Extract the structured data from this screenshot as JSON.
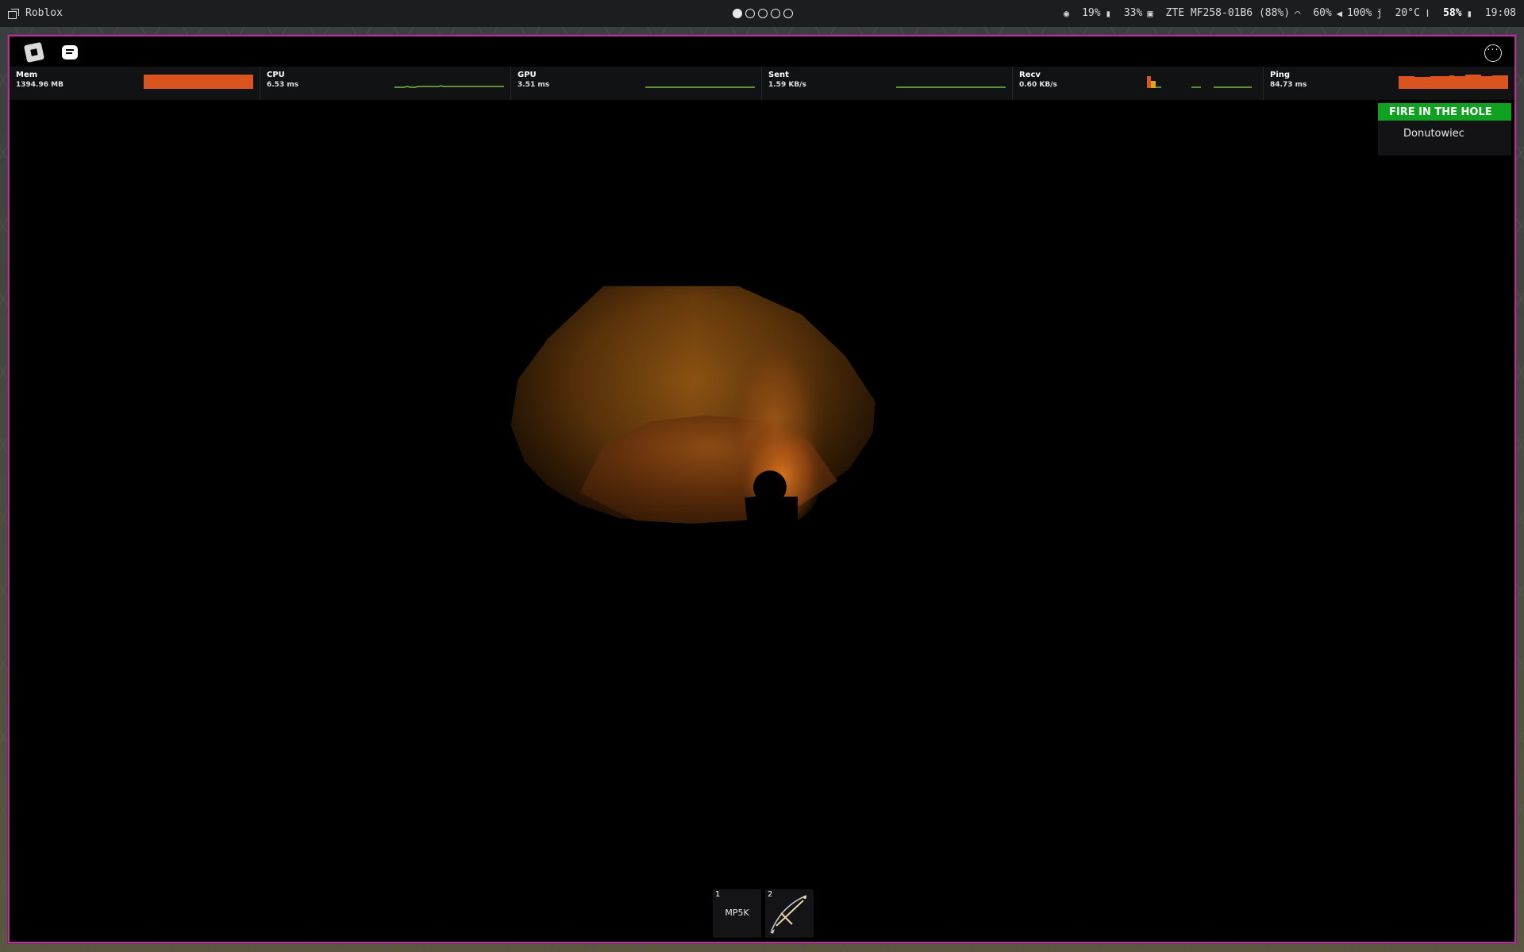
{
  "taskbar": {
    "window_title": "Roblox",
    "workspaces": [
      true,
      false,
      false,
      false,
      false
    ],
    "status": {
      "cpu": "19%",
      "gpu": "33%",
      "network": "ZTE MF258-01B6 (88%)",
      "brightness": "60%",
      "volume": "100%",
      "temperature": "20°C",
      "battery": "58%",
      "clock": "19:08"
    }
  },
  "game": {
    "perf": [
      {
        "label": "Mem",
        "value": "1394.96 MB"
      },
      {
        "label": "CPU",
        "value": "6.53 ms"
      },
      {
        "label": "GPU",
        "value": "3.51 ms"
      },
      {
        "label": "Sent",
        "value": "1.59 KB/s"
      },
      {
        "label": "Recv",
        "value": "0.60 KB/s"
      },
      {
        "label": "Ping",
        "value": "84.73 ms"
      }
    ],
    "leaderboard": {
      "title": "FIRE IN THE HOLE",
      "player": "Donutowiec"
    },
    "hotbar": [
      {
        "num": "1",
        "label": "MP5K"
      },
      {
        "num": "2",
        "label": ""
      }
    ]
  },
  "colors": {
    "accent_green": "#0fa11f",
    "perf_bar": "#d9541e",
    "perf_line": "#8ee04a",
    "window_border": "#b03a7a"
  }
}
